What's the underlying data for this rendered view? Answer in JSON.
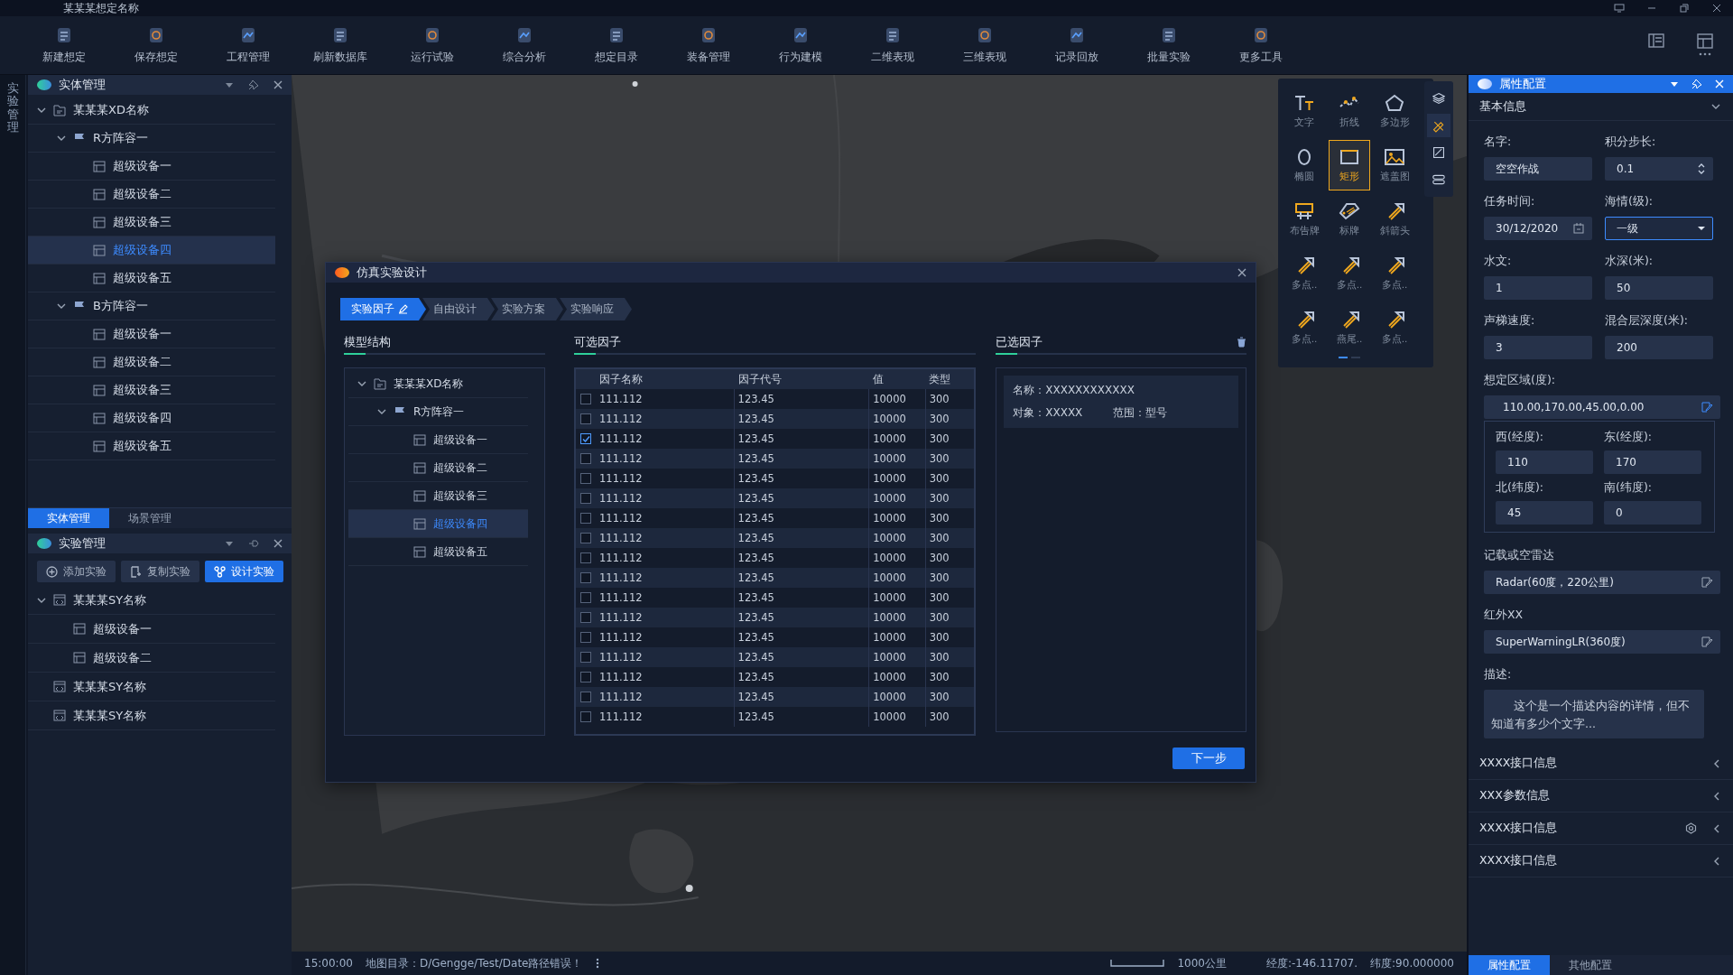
{
  "window": {
    "title": "某某某想定名称"
  },
  "toolbar": [
    {
      "label": "新建想定"
    },
    {
      "label": "保存想定"
    },
    {
      "label": "工程管理"
    },
    {
      "label": "刷新数据库"
    },
    {
      "label": "运行试验"
    },
    {
      "label": "综合分析"
    },
    {
      "label": "想定目录"
    },
    {
      "label": "装备管理"
    },
    {
      "label": "行为建模"
    },
    {
      "label": "二维表现"
    },
    {
      "label": "三维表现"
    },
    {
      "label": "记录回放"
    },
    {
      "label": "批量实验"
    },
    {
      "label": "更多工具"
    }
  ],
  "side_tab": {
    "label": "实验管理"
  },
  "entity_panel": {
    "title": "实体管理",
    "tree": [
      {
        "label": "某某某XD名称",
        "kind": "scenario",
        "selected": false,
        "expanded": true,
        "children": [
          {
            "label": "R方阵容一",
            "kind": "group",
            "selected": false,
            "expanded": true,
            "children": [
              {
                "label": "超级设备一",
                "kind": "device",
                "selected": false
              },
              {
                "label": "超级设备二",
                "kind": "device",
                "selected": false
              },
              {
                "label": "超级设备三",
                "kind": "device",
                "selected": false
              },
              {
                "label": "超级设备四",
                "kind": "device",
                "selected": true
              },
              {
                "label": "超级设备五",
                "kind": "device",
                "selected": false
              }
            ]
          },
          {
            "label": "B方阵容一",
            "kind": "group",
            "selected": false,
            "expanded": true,
            "children": [
              {
                "label": "超级设备一",
                "kind": "device",
                "selected": false
              },
              {
                "label": "超级设备二",
                "kind": "device",
                "selected": false
              },
              {
                "label": "超级设备三",
                "kind": "device",
                "selected": false
              },
              {
                "label": "超级设备四",
                "kind": "device",
                "selected": false
              },
              {
                "label": "超级设备五",
                "kind": "device",
                "selected": false
              }
            ]
          }
        ]
      }
    ]
  },
  "left_tabs": [
    {
      "label": "实体管理",
      "selected": true
    },
    {
      "label": "场景管理",
      "selected": false
    }
  ],
  "experiment_panel": {
    "title": "实验管理",
    "buttons": [
      {
        "label": "添加实验",
        "kind": "add",
        "primary": false
      },
      {
        "label": "复制实验",
        "kind": "copy",
        "primary": false
      },
      {
        "label": "设计实验",
        "kind": "design",
        "primary": true
      }
    ],
    "tree": [
      {
        "label": "某某某SY名称",
        "kind": "experiment",
        "selected": false,
        "expanded": true,
        "children": [
          {
            "label": "超级设备一",
            "kind": "device",
            "selected": false
          },
          {
            "label": "超级设备二",
            "kind": "device",
            "selected": false
          }
        ]
      },
      {
        "label": "某某某SY名称",
        "kind": "experiment",
        "selected": false
      },
      {
        "label": "某某某SY名称",
        "kind": "experiment",
        "selected": false
      }
    ]
  },
  "dialog": {
    "title": "仿真实验设计",
    "steps": [
      {
        "label": "实验因子",
        "selected": true
      },
      {
        "label": "自由设计",
        "selected": false
      },
      {
        "label": "实验方案",
        "selected": false
      },
      {
        "label": "实验响应",
        "selected": false
      }
    ],
    "model_structure": {
      "title": "模型结构",
      "tree": [
        {
          "label": "某某某XD名称",
          "kind": "scenario",
          "selected": false,
          "expanded": true,
          "children": [
            {
              "label": "R方阵容一",
              "kind": "group",
              "selected": false,
              "expanded": true,
              "children": [
                {
                  "label": "超级设备一",
                  "kind": "device",
                  "selected": false
                },
                {
                  "label": "超级设备二",
                  "kind": "device",
                  "selected": false
                },
                {
                  "label": "超级设备三",
                  "kind": "device",
                  "selected": false
                },
                {
                  "label": "超级设备四",
                  "kind": "device",
                  "selected": true
                },
                {
                  "label": "超级设备五",
                  "kind": "device",
                  "selected": false
                }
              ]
            }
          ]
        }
      ]
    },
    "factors": {
      "title": "可选因子",
      "columns": [
        "因子名称",
        "因子代号",
        "值",
        "类型"
      ],
      "rows": [
        {
          "name": "111.112",
          "code": "123.45",
          "value": "10000",
          "type": "300",
          "checked": false
        },
        {
          "name": "111.112",
          "code": "123.45",
          "value": "10000",
          "type": "300",
          "checked": false
        },
        {
          "name": "111.112",
          "code": "123.45",
          "value": "10000",
          "type": "300",
          "checked": true
        },
        {
          "name": "111.112",
          "code": "123.45",
          "value": "10000",
          "type": "300",
          "checked": false
        },
        {
          "name": "111.112",
          "code": "123.45",
          "value": "10000",
          "type": "300",
          "checked": false
        },
        {
          "name": "111.112",
          "code": "123.45",
          "value": "10000",
          "type": "300",
          "checked": false
        },
        {
          "name": "111.112",
          "code": "123.45",
          "value": "10000",
          "type": "300",
          "checked": false
        },
        {
          "name": "111.112",
          "code": "123.45",
          "value": "10000",
          "type": "300",
          "checked": false
        },
        {
          "name": "111.112",
          "code": "123.45",
          "value": "10000",
          "type": "300",
          "checked": false
        },
        {
          "name": "111.112",
          "code": "123.45",
          "value": "10000",
          "type": "300",
          "checked": false
        },
        {
          "name": "111.112",
          "code": "123.45",
          "value": "10000",
          "type": "300",
          "checked": false
        },
        {
          "name": "111.112",
          "code": "123.45",
          "value": "10000",
          "type": "300",
          "checked": false
        },
        {
          "name": "111.112",
          "code": "123.45",
          "value": "10000",
          "type": "300",
          "checked": false
        },
        {
          "name": "111.112",
          "code": "123.45",
          "value": "10000",
          "type": "300",
          "checked": false
        },
        {
          "name": "111.112",
          "code": "123.45",
          "value": "10000",
          "type": "300",
          "checked": false
        },
        {
          "name": "111.112",
          "code": "123.45",
          "value": "10000",
          "type": "300",
          "checked": false
        },
        {
          "name": "111.112",
          "code": "123.45",
          "value": "10000",
          "type": "300",
          "checked": false
        }
      ]
    },
    "selected_factors": {
      "title": "已选因子",
      "items": [
        {
          "name": "名称：XXXXXXXXXXXX",
          "object": "对象：XXXXX",
          "range": "范围：型号"
        }
      ]
    },
    "next_button": "下一步"
  },
  "draw_tools": [
    {
      "label": "文字",
      "selected": false
    },
    {
      "label": "折线",
      "selected": false
    },
    {
      "label": "多边形",
      "selected": false
    },
    {
      "label": "椭圆",
      "selected": false
    },
    {
      "label": "矩形",
      "selected": true
    },
    {
      "label": "遮盖图",
      "selected": false
    },
    {
      "label": "布告牌",
      "selected": false
    },
    {
      "label": "标牌",
      "selected": false
    },
    {
      "label": "斜箭头",
      "selected": false
    },
    {
      "label": "多点..",
      "selected": false
    },
    {
      "label": "多点..",
      "selected": false
    },
    {
      "label": "多点..",
      "selected": false
    },
    {
      "label": "多点..",
      "selected": false
    },
    {
      "label": "燕尾..",
      "selected": false
    },
    {
      "label": "多点..",
      "selected": false
    }
  ],
  "property_panel": {
    "title": "属性配置",
    "section": {
      "label": "基本信息",
      "expanded": true
    },
    "fields": [
      {
        "label": "名字:",
        "value": "空空作战",
        "kind": "text"
      },
      {
        "label": "积分步长:",
        "value": "0.1",
        "kind": "spinner"
      },
      {
        "label": "任务时间:",
        "value": "30/12/2020",
        "kind": "date"
      },
      {
        "label": "海情(级):",
        "value": "一级",
        "kind": "select"
      },
      {
        "label": "水文:",
        "value": "1",
        "kind": "text"
      },
      {
        "label": "水深(米):",
        "value": "50",
        "kind": "text"
      },
      {
        "label": "声梯速度:",
        "value": "3",
        "kind": "text"
      },
      {
        "label": "混合层深度(米):",
        "value": "200",
        "kind": "text"
      }
    ],
    "region": {
      "label": "想定区域(度):",
      "value": "110.00,170.00,45.00,0.00",
      "fields": [
        {
          "label": "西(经度):",
          "value": "110"
        },
        {
          "label": "东(经度):",
          "value": "170"
        },
        {
          "label": "北(纬度):",
          "value": "45"
        },
        {
          "label": "南(纬度):",
          "value": "0"
        }
      ]
    },
    "pickers": [
      {
        "label": "记载或空雷达",
        "value": "Radar(60度，220公里)"
      },
      {
        "label": "红外XX",
        "value": "SuperWarningLR(360度)"
      }
    ],
    "description": {
      "label": "描述:",
      "value": "这个是一个描述内容的详情，但不知道有多少个文字..."
    },
    "sections": [
      {
        "label": "XXXX接口信息",
        "expanded": false,
        "settings": false
      },
      {
        "label": "XXX参数信息",
        "expanded": false,
        "settings": false
      },
      {
        "label": "XXXX接口信息",
        "expanded": false,
        "settings": true
      },
      {
        "label": "XXXX接口信息",
        "expanded": false,
        "settings": false
      }
    ],
    "tabs": [
      {
        "label": "属性配置",
        "selected": true
      },
      {
        "label": "其他配置",
        "selected": false
      }
    ]
  },
  "status_bar": {
    "time": "15:00:00",
    "message": "地图目录：D/Gengge/Test/Date路径错误！",
    "scale": "1000公里",
    "longitude": "经度:-146.11707.",
    "latitude": "纬度:90.000000"
  }
}
